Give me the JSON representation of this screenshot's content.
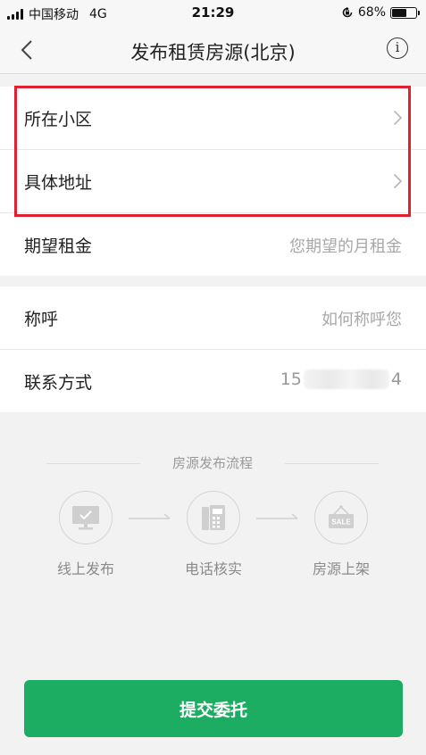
{
  "status_bar": {
    "carrier": "中国移动",
    "network": "4G",
    "time": "21:29",
    "battery": "68%",
    "battery_level": 0.68,
    "icons": [
      "signal-icon",
      "orientation-lock-icon",
      "battery-icon"
    ]
  },
  "nav": {
    "title": "发布租赁房源(北京)",
    "back_icon": "chevron-left-icon",
    "info_icon": "info-icon",
    "info_glyph": "i"
  },
  "form": {
    "community": {
      "label": "所在小区"
    },
    "address": {
      "label": "具体地址"
    },
    "rent": {
      "label": "期望租金",
      "placeholder": "您期望的月租金"
    },
    "name": {
      "label": "称呼",
      "placeholder": "如何称呼您"
    },
    "contact": {
      "label": "联系方式",
      "value_start": "15",
      "value_end": "4"
    }
  },
  "process": {
    "title": "房源发布流程",
    "steps": [
      {
        "label": "线上发布",
        "icon": "monitor-check-icon"
      },
      {
        "label": "电话核实",
        "icon": "telephone-icon"
      },
      {
        "label": "房源上架",
        "icon": "sale-sign-icon",
        "sign_text": "SALE"
      }
    ]
  },
  "submit": {
    "label": "提交委托"
  },
  "colors": {
    "accent": "#1cad62",
    "highlight": "#e0202c",
    "background": "#f2f2f2"
  }
}
